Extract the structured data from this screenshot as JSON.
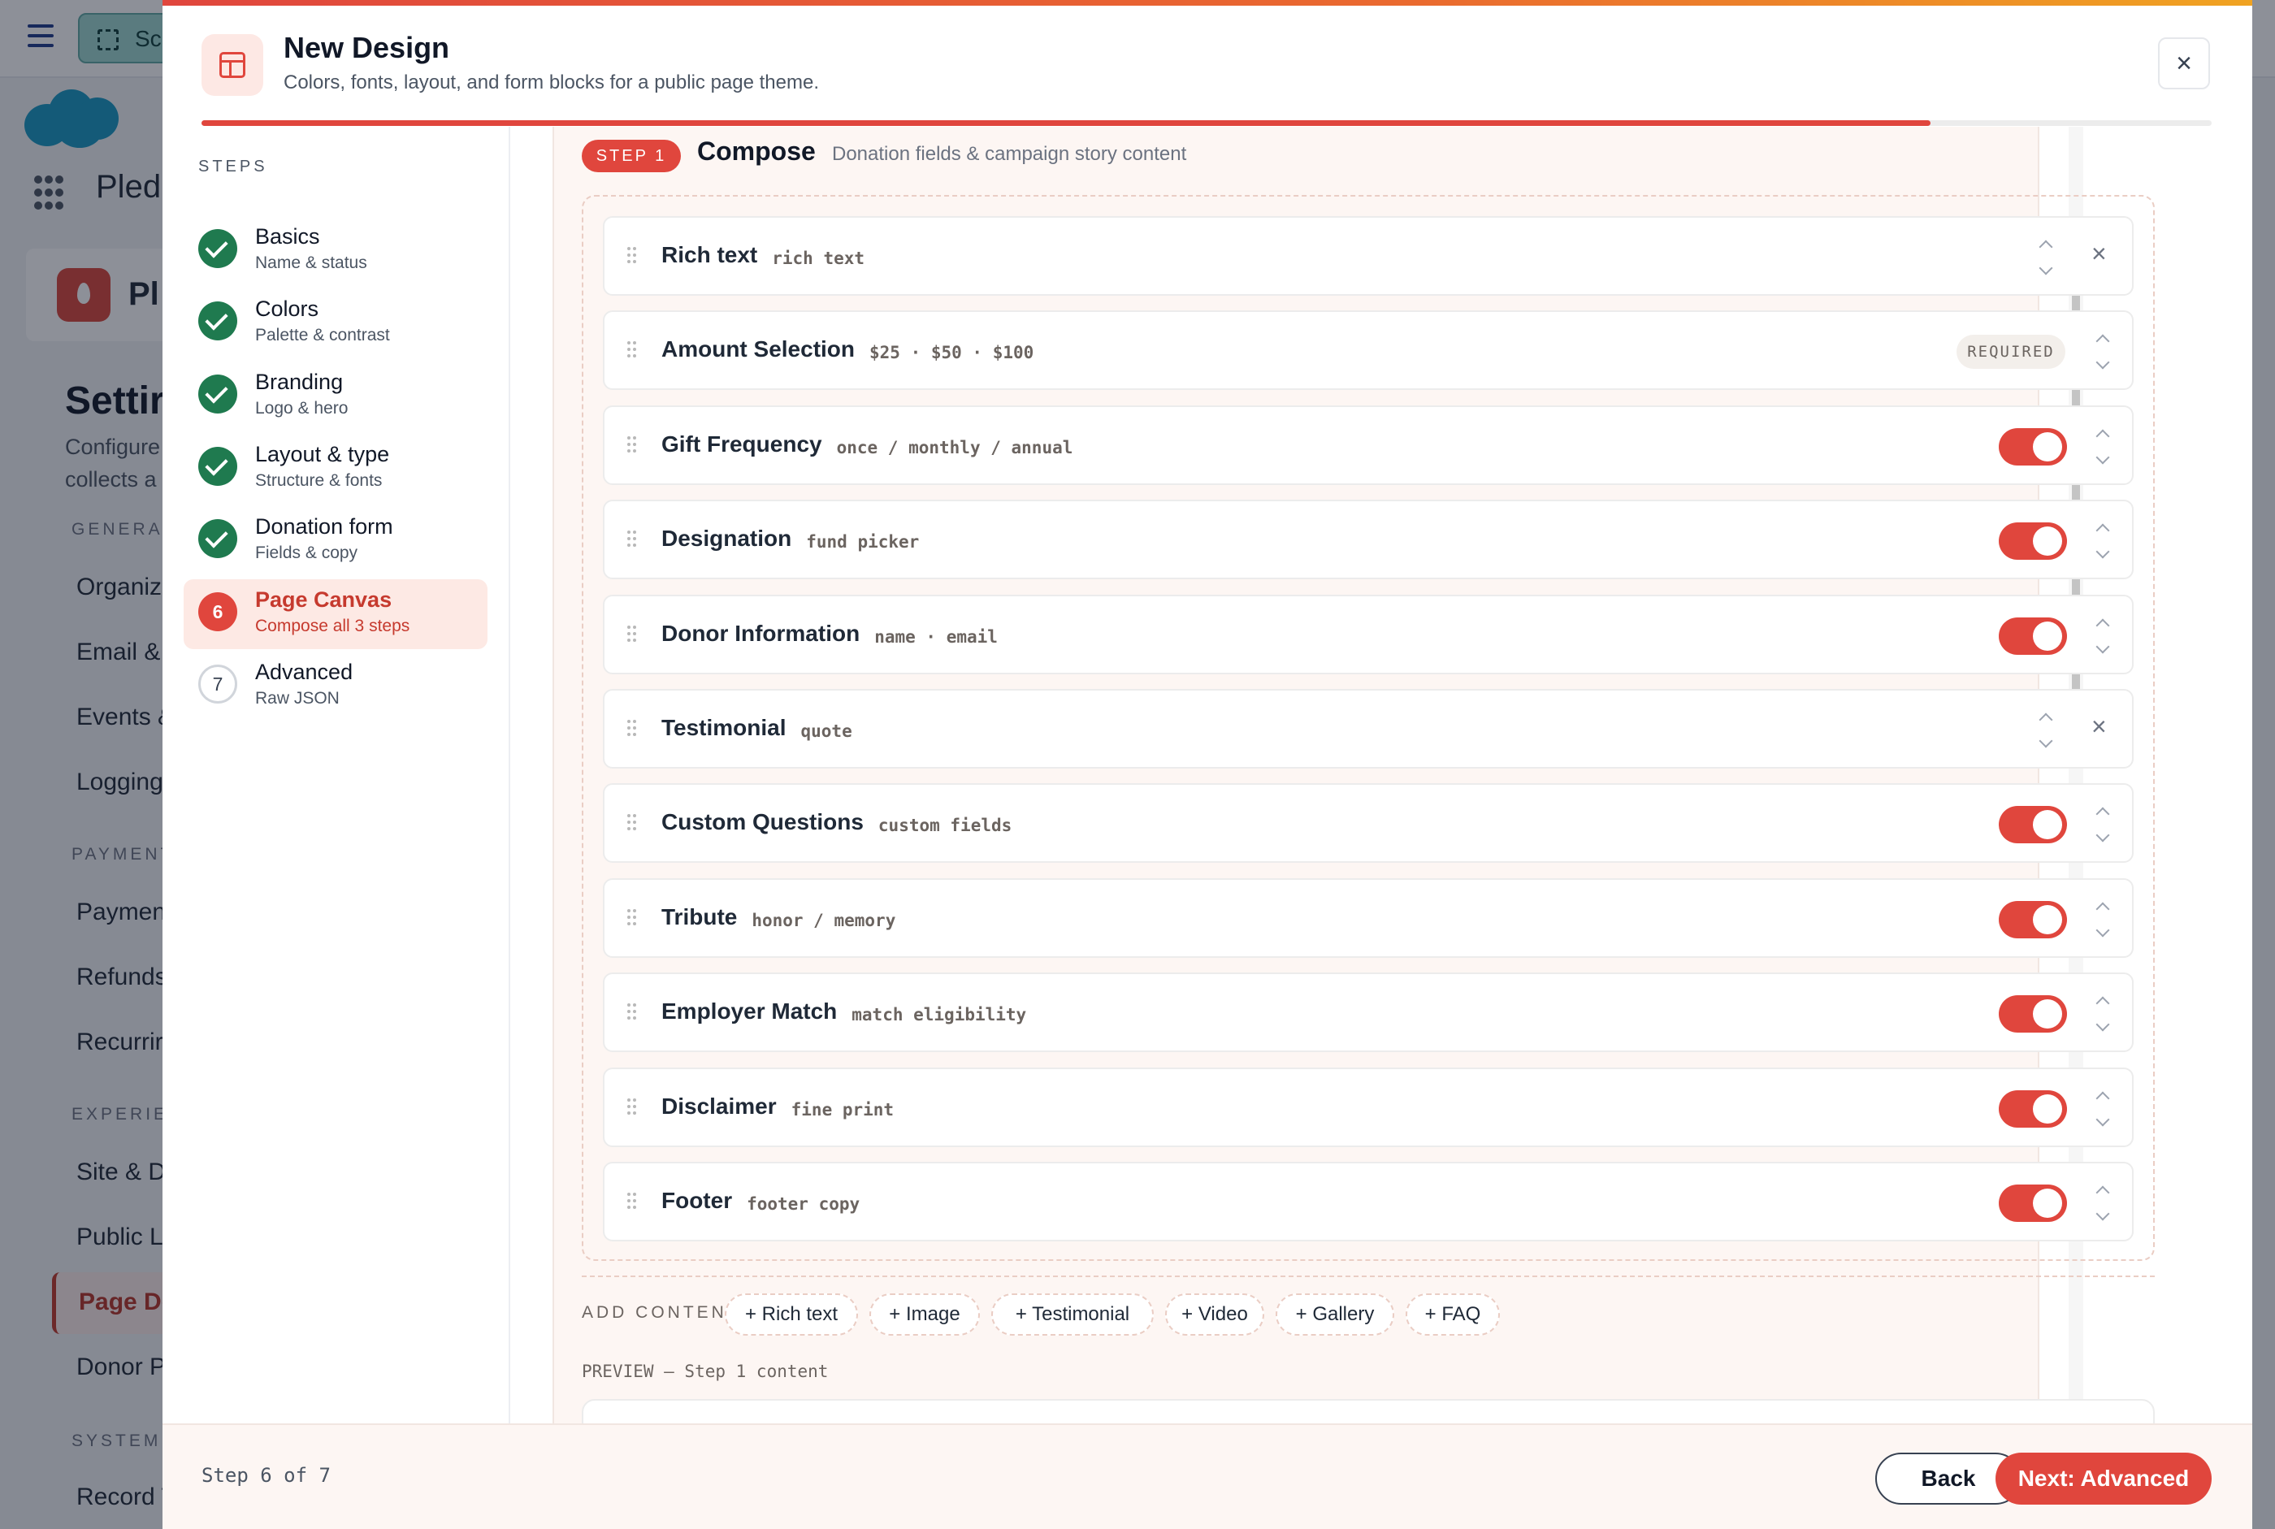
{
  "background_app": {
    "scope_button": "Sc",
    "app_name": "Pled",
    "card_title": "Pl",
    "page_title": "Settir",
    "description_lines": [
      "Configure",
      "collects a"
    ],
    "sections": [
      {
        "label": "GENERAL",
        "items": [
          "Organiz",
          "Email &",
          "Events &",
          "Logging"
        ]
      },
      {
        "label": "PAYMENTS",
        "items": [
          "Paymen",
          "Refunds",
          "Recurrir"
        ]
      },
      {
        "label": "EXPERIEN",
        "items": [
          "Site & D",
          "Public L",
          "Page De",
          "Donor P"
        ]
      },
      {
        "label": "SYSTEM",
        "items": [
          "Record T"
        ]
      }
    ],
    "active_item": "Page De"
  },
  "modal": {
    "title": "New Design",
    "subtitle": "Colors, fonts, layout, and form blocks for a public page theme.",
    "close_icon": "×",
    "progress_fraction": 0.86,
    "accent_color": "#e0463d"
  },
  "steps": {
    "label": "STEPS",
    "items": [
      {
        "number": "1",
        "name": "Basics",
        "desc": "Name & status",
        "status": "done"
      },
      {
        "number": "2",
        "name": "Colors",
        "desc": "Palette & contrast",
        "status": "done"
      },
      {
        "number": "3",
        "name": "Branding",
        "desc": "Logo & hero",
        "status": "done"
      },
      {
        "number": "4",
        "name": "Layout & type",
        "desc": "Structure & fonts",
        "status": "done"
      },
      {
        "number": "5",
        "name": "Donation form",
        "desc": "Fields & copy",
        "status": "done"
      },
      {
        "number": "6",
        "name": "Page Canvas",
        "desc": "Compose all 3 steps",
        "status": "current"
      },
      {
        "number": "7",
        "name": "Advanced",
        "desc": "Raw JSON",
        "status": "todo"
      }
    ]
  },
  "canvas": {
    "step_badge": "STEP 1",
    "title": "Compose",
    "subtitle": "Donation fields & campaign story content",
    "blocks": [
      {
        "name": "Rich text",
        "tag": "rich text",
        "control": "remove"
      },
      {
        "name": "Amount Selection",
        "tag": "$25 · $50 · $100",
        "control": "required",
        "badge": "REQUIRED"
      },
      {
        "name": "Gift Frequency",
        "tag": "once / monthly / annual",
        "control": "toggle",
        "enabled": true
      },
      {
        "name": "Designation",
        "tag": "fund picker",
        "control": "toggle",
        "enabled": true
      },
      {
        "name": "Donor Information",
        "tag": "name · email",
        "control": "toggle",
        "enabled": true
      },
      {
        "name": "Testimonial",
        "tag": "quote",
        "control": "remove"
      },
      {
        "name": "Custom Questions",
        "tag": "custom fields",
        "control": "toggle",
        "enabled": true
      },
      {
        "name": "Tribute",
        "tag": "honor / memory",
        "control": "toggle",
        "enabled": true
      },
      {
        "name": "Employer Match",
        "tag": "match eligibility",
        "control": "toggle",
        "enabled": true
      },
      {
        "name": "Disclaimer",
        "tag": "fine print",
        "control": "toggle",
        "enabled": true
      },
      {
        "name": "Footer",
        "tag": "footer copy",
        "control": "toggle",
        "enabled": true
      }
    ],
    "add_content": {
      "label": "ADD CONTENT",
      "buttons": [
        "+ Rich text",
        "+ Image",
        "+ Testimonial",
        "+ Video",
        "+ Gallery",
        "+ FAQ"
      ]
    },
    "preview_label": "PREVIEW — Step 1 content"
  },
  "footer": {
    "step_text": "Step 6 of 7",
    "back_label": "Back",
    "next_label": "Next: Advanced"
  }
}
